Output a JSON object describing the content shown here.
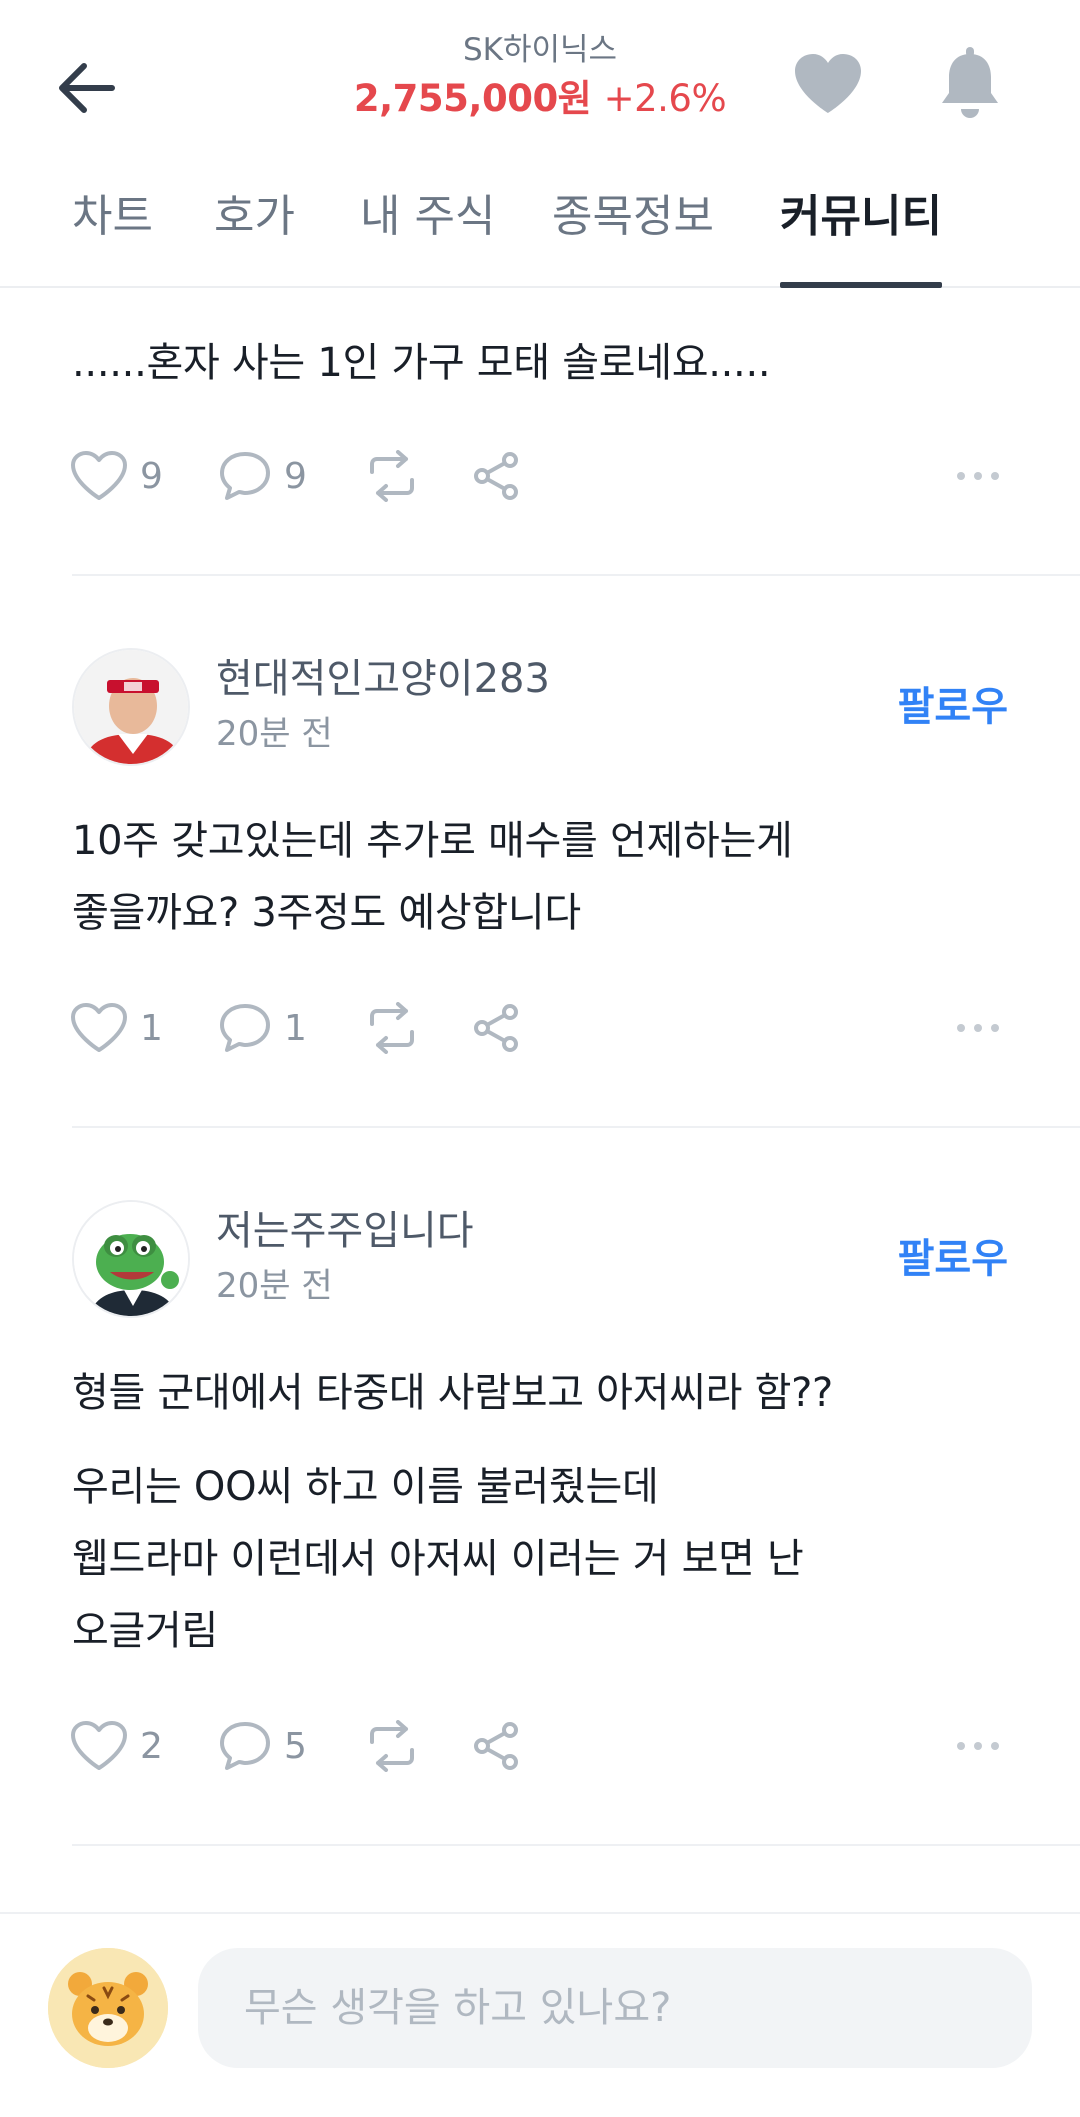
{
  "header": {
    "stock_name": "SK하이닉스",
    "price": "2,755,000원",
    "change": "+2.6%",
    "price_color": "#e5484d"
  },
  "icons": {
    "back": "back-arrow-icon",
    "favorite": "heart-icon",
    "notifications": "bell-icon"
  },
  "tabs": [
    {
      "label": "차트",
      "active": false
    },
    {
      "label": "호가",
      "active": false
    },
    {
      "label": "내 주식",
      "active": false
    },
    {
      "label": "종목정보",
      "active": false
    },
    {
      "label": "커뮤니티",
      "active": true
    }
  ],
  "posts": [
    {
      "text_lines": [
        "......혼자 사는 1인 가구 모태 솔로네요....."
      ],
      "likes": "9",
      "comments": "9"
    },
    {
      "author": "현대적인고양이283",
      "time": "20분 전",
      "follow_label": "팔로우",
      "text_lines": [
        "10주 갖고있는데 추가로 매수를 언제하는게",
        "좋을까요? 3주정도 예상합니다"
      ],
      "likes": "1",
      "comments": "1"
    },
    {
      "author": "저는주주입니다",
      "time": "20분 전",
      "follow_label": "팔로우",
      "text_lines": [
        "형들 군대에서 타중대 사람보고 아저씨라 함??",
        "우리는 OO씨 하고 이름 불러줬는데",
        "웹드라마 이런데서 아저씨 이러는 거 보면 난",
        "오글거림"
      ],
      "likes": "2",
      "comments": "5"
    }
  ],
  "compose": {
    "placeholder": "무슨 생각을 하고 있나요?"
  },
  "colors": {
    "accent_blue": "#3182f6",
    "icon_gray": "#b0b8c1"
  }
}
